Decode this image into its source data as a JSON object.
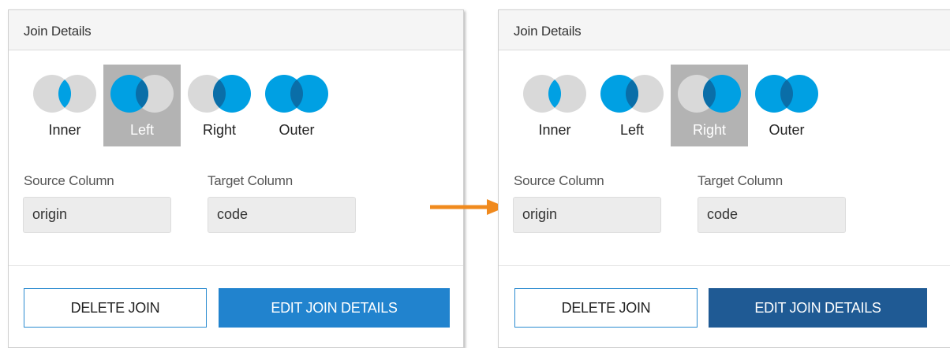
{
  "colors": {
    "accent_blue": "#00a0e3",
    "overlap_blue": "#0a6ea8",
    "circle_gray": "#d9d9d9",
    "active_bg": "#b3b3b3",
    "edit_button_default": "#2183ce",
    "edit_button_hover": "#1f5a94",
    "arrow": "#f08a1e"
  },
  "panels": [
    {
      "title": "Join Details",
      "join_types": [
        {
          "label": "Inner",
          "icon": "inner-join-icon",
          "active": false
        },
        {
          "label": "Left",
          "icon": "left-join-icon",
          "active": true
        },
        {
          "label": "Right",
          "icon": "right-join-icon",
          "active": false
        },
        {
          "label": "Outer",
          "icon": "outer-join-icon",
          "active": false
        }
      ],
      "source_column_label": "Source Column",
      "source_column_value": "origin",
      "target_column_label": "Target Column",
      "target_column_value": "code",
      "delete_label": "DELETE JOIN",
      "edit_label": "EDIT JOIN DETAILS"
    },
    {
      "title": "Join Details",
      "join_types": [
        {
          "label": "Inner",
          "icon": "inner-join-icon",
          "active": false
        },
        {
          "label": "Left",
          "icon": "left-join-icon",
          "active": false
        },
        {
          "label": "Right",
          "icon": "right-join-icon",
          "active": true
        },
        {
          "label": "Outer",
          "icon": "outer-join-icon",
          "active": false
        }
      ],
      "source_column_label": "Source Column",
      "source_column_value": "origin",
      "target_column_label": "Target Column",
      "target_column_value": "code",
      "delete_label": "DELETE JOIN",
      "edit_label": "EDIT JOIN DETAILS"
    }
  ],
  "arrow_icon": "right-arrow-icon"
}
